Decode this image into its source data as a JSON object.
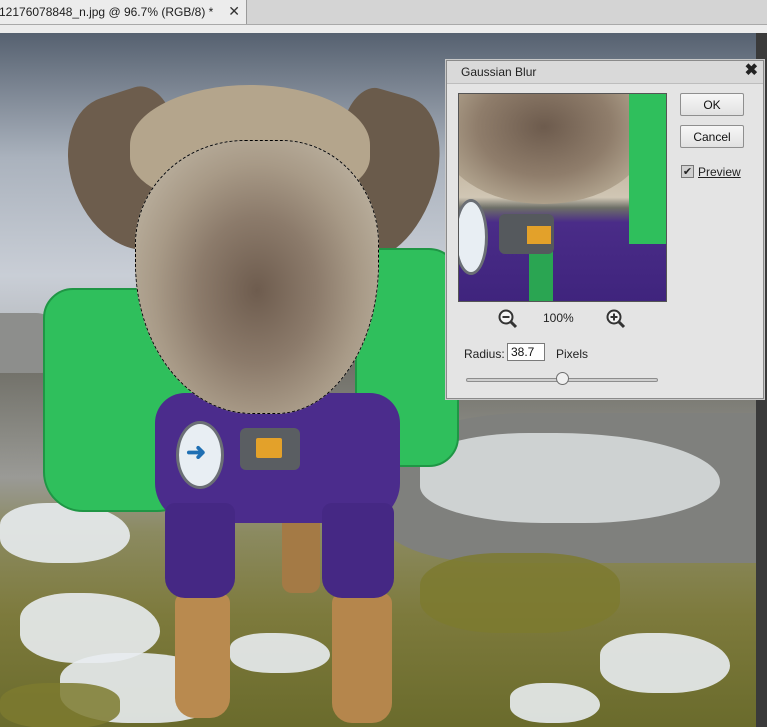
{
  "document_tab": {
    "title": "12176078848_n.jpg @ 96.7% (RGB/8) *",
    "close_glyph": "✕"
  },
  "dialog": {
    "title": "Gaussian Blur",
    "close_glyph": "✖",
    "ok_label": "OK",
    "cancel_label": "Cancel",
    "preview_checked": true,
    "preview_check_glyph": "✔",
    "preview_label": "Preview",
    "zoom_level": "100%",
    "zoom_out_icon": "zoom-out-icon",
    "zoom_in_icon": "zoom-in-icon",
    "radius_label": "Radius:",
    "radius_value": "38.7",
    "radius_unit": "Pixels",
    "radius_slider_fraction": 0.5
  },
  "colors": {
    "harness_green": "#2fbf5c",
    "sweater_purple": "#4b2c8c",
    "dialog_bg": "#e4e4e4"
  }
}
